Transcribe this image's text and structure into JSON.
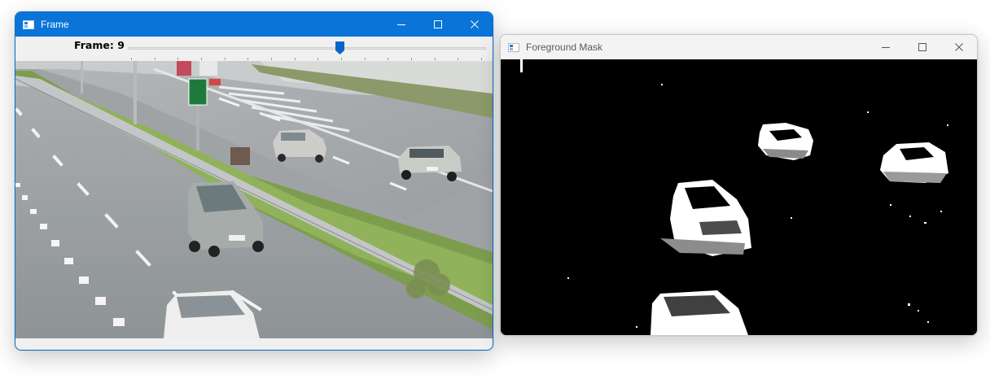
{
  "windows": {
    "frame": {
      "title": "Frame",
      "trackbar": {
        "label": "Frame: 9",
        "value_fraction": 0.59
      },
      "video_image": "video frame: highway with cars",
      "controls": [
        "minimize",
        "maximize",
        "close"
      ]
    },
    "mask": {
      "title": "Foreground Mask",
      "mask_image": "black background with white silhouettes of moving cars",
      "controls": [
        "minimize",
        "maximize",
        "close"
      ]
    }
  },
  "colors": {
    "active_titlebar": "#0a74d9",
    "inactive_titlebar": "#f3f3f3",
    "slider_thumb": "#0a64c8"
  },
  "icons": [
    "app-icon",
    "minimize-icon",
    "maximize-icon",
    "close-icon",
    "slider-thumb"
  ]
}
